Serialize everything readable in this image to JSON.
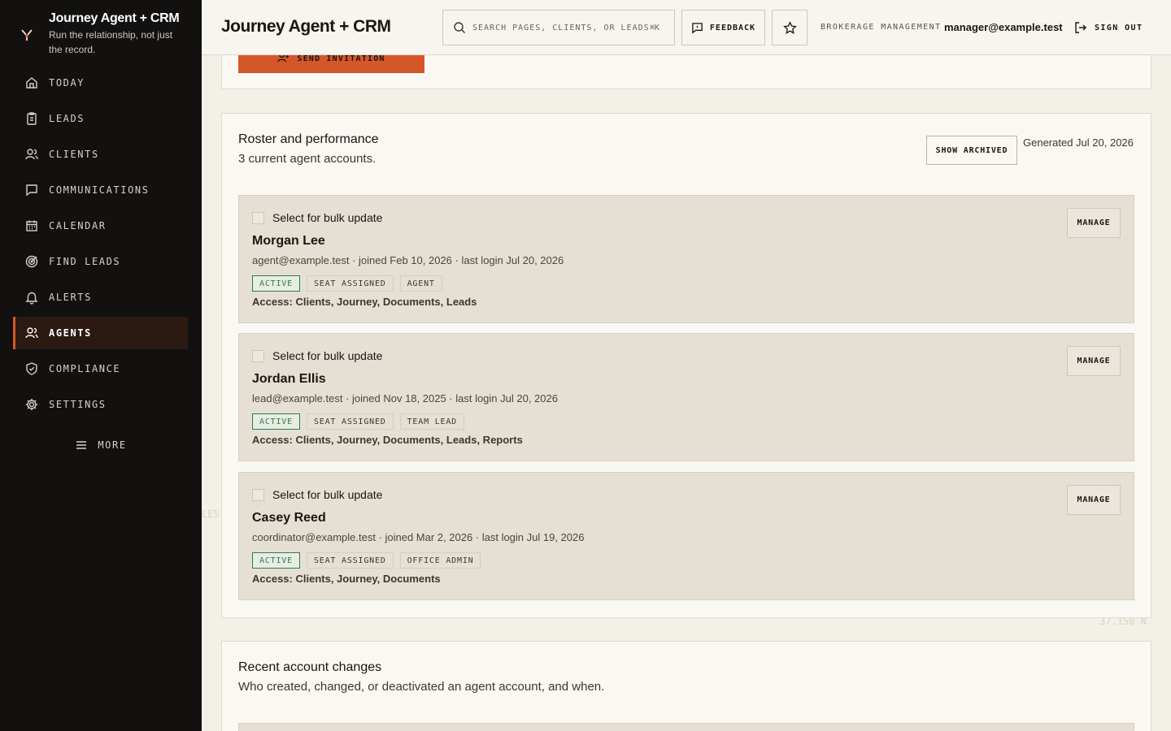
{
  "brand": {
    "title": "Journey Agent + CRM",
    "subtitle": "Run the relationship, not just the record."
  },
  "sidebar": {
    "items": [
      {
        "label": "TODAY",
        "icon": "home-icon"
      },
      {
        "label": "LEADS",
        "icon": "clipboard-icon"
      },
      {
        "label": "CLIENTS",
        "icon": "users-icon"
      },
      {
        "label": "COMMUNICATIONS",
        "icon": "message-icon"
      },
      {
        "label": "CALENDAR",
        "icon": "calendar-icon"
      },
      {
        "label": "FIND LEADS",
        "icon": "target-icon"
      },
      {
        "label": "ALERTS",
        "icon": "bell-icon"
      },
      {
        "label": "AGENTS",
        "icon": "users-icon",
        "active": true
      },
      {
        "label": "COMPLIANCE",
        "icon": "shield-check-icon"
      },
      {
        "label": "SETTINGS",
        "icon": "gear-icon"
      }
    ],
    "more_label": "MORE"
  },
  "topbar": {
    "title": "Journey Agent + CRM",
    "search_placeholder": "SEARCH PAGES, CLIENTS, OR LEADS",
    "search_shortcut": "⌘K",
    "feedback_label": "FEEDBACK",
    "role": "BROKERAGE MANAGEMENT",
    "email": "manager@example.test",
    "signout_label": "SIGN OUT"
  },
  "invite": {
    "button_label": "SEND INVITATION"
  },
  "roster": {
    "title": "Roster and performance",
    "subtitle": "3 current agent accounts.",
    "show_archived_label": "SHOW ARCHIVED",
    "generated": "Generated Jul 20, 2026",
    "select_label": "Select for bulk update",
    "manage_label": "MANAGE",
    "agents": [
      {
        "name": "Morgan Lee",
        "meta": "agent@example.test · joined Feb 10, 2026 · last login Jul 20, 2026",
        "tags": [
          "ACTIVE",
          "SEAT ASSIGNED",
          "AGENT"
        ],
        "access": "Access: Clients, Journey, Documents, Leads"
      },
      {
        "name": "Jordan Ellis",
        "meta": "lead@example.test · joined Nov 18, 2025 · last login Jul 20, 2026",
        "tags": [
          "ACTIVE",
          "SEAT ASSIGNED",
          "TEAM LEAD"
        ],
        "access": "Access: Clients, Journey, Documents, Leads, Reports"
      },
      {
        "name": "Casey Reed",
        "meta": "coordinator@example.test · joined Mar 2, 2026 · last login Jul 19, 2026",
        "tags": [
          "ACTIVE",
          "SEAT ASSIGNED",
          "OFFICE ADMIN"
        ],
        "access": "Access: Clients, Journey, Documents"
      }
    ]
  },
  "recent": {
    "title": "Recent account changes",
    "subtitle": "Who created, changed, or deactivated an agent account, and when."
  },
  "background": {
    "coord_label": "37.150 N",
    "edge_label": "LES"
  },
  "colors": {
    "accent": "#d4572a",
    "sidebar_bg": "#121110",
    "active_green": "#2f7a52"
  }
}
